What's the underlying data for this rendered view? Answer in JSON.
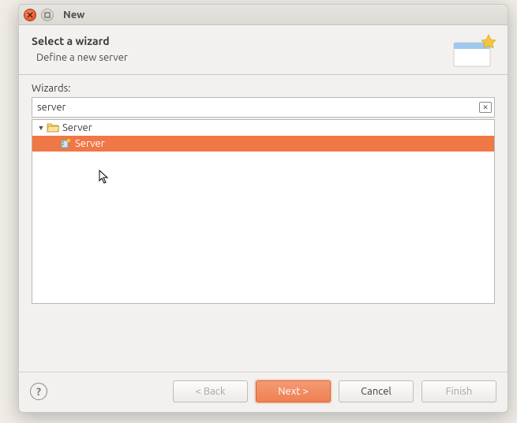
{
  "window": {
    "title": "New"
  },
  "header": {
    "title": "Select a wizard",
    "subtitle": "Define a new server"
  },
  "wizards": {
    "label": "Wizards:",
    "search_value": "server"
  },
  "tree": {
    "category": {
      "label": "Server",
      "expanded": true
    },
    "item": {
      "label": "Server",
      "selected": true
    }
  },
  "buttons": {
    "back": "< Back",
    "next": "Next >",
    "cancel": "Cancel",
    "finish": "Finish",
    "help": "?"
  }
}
